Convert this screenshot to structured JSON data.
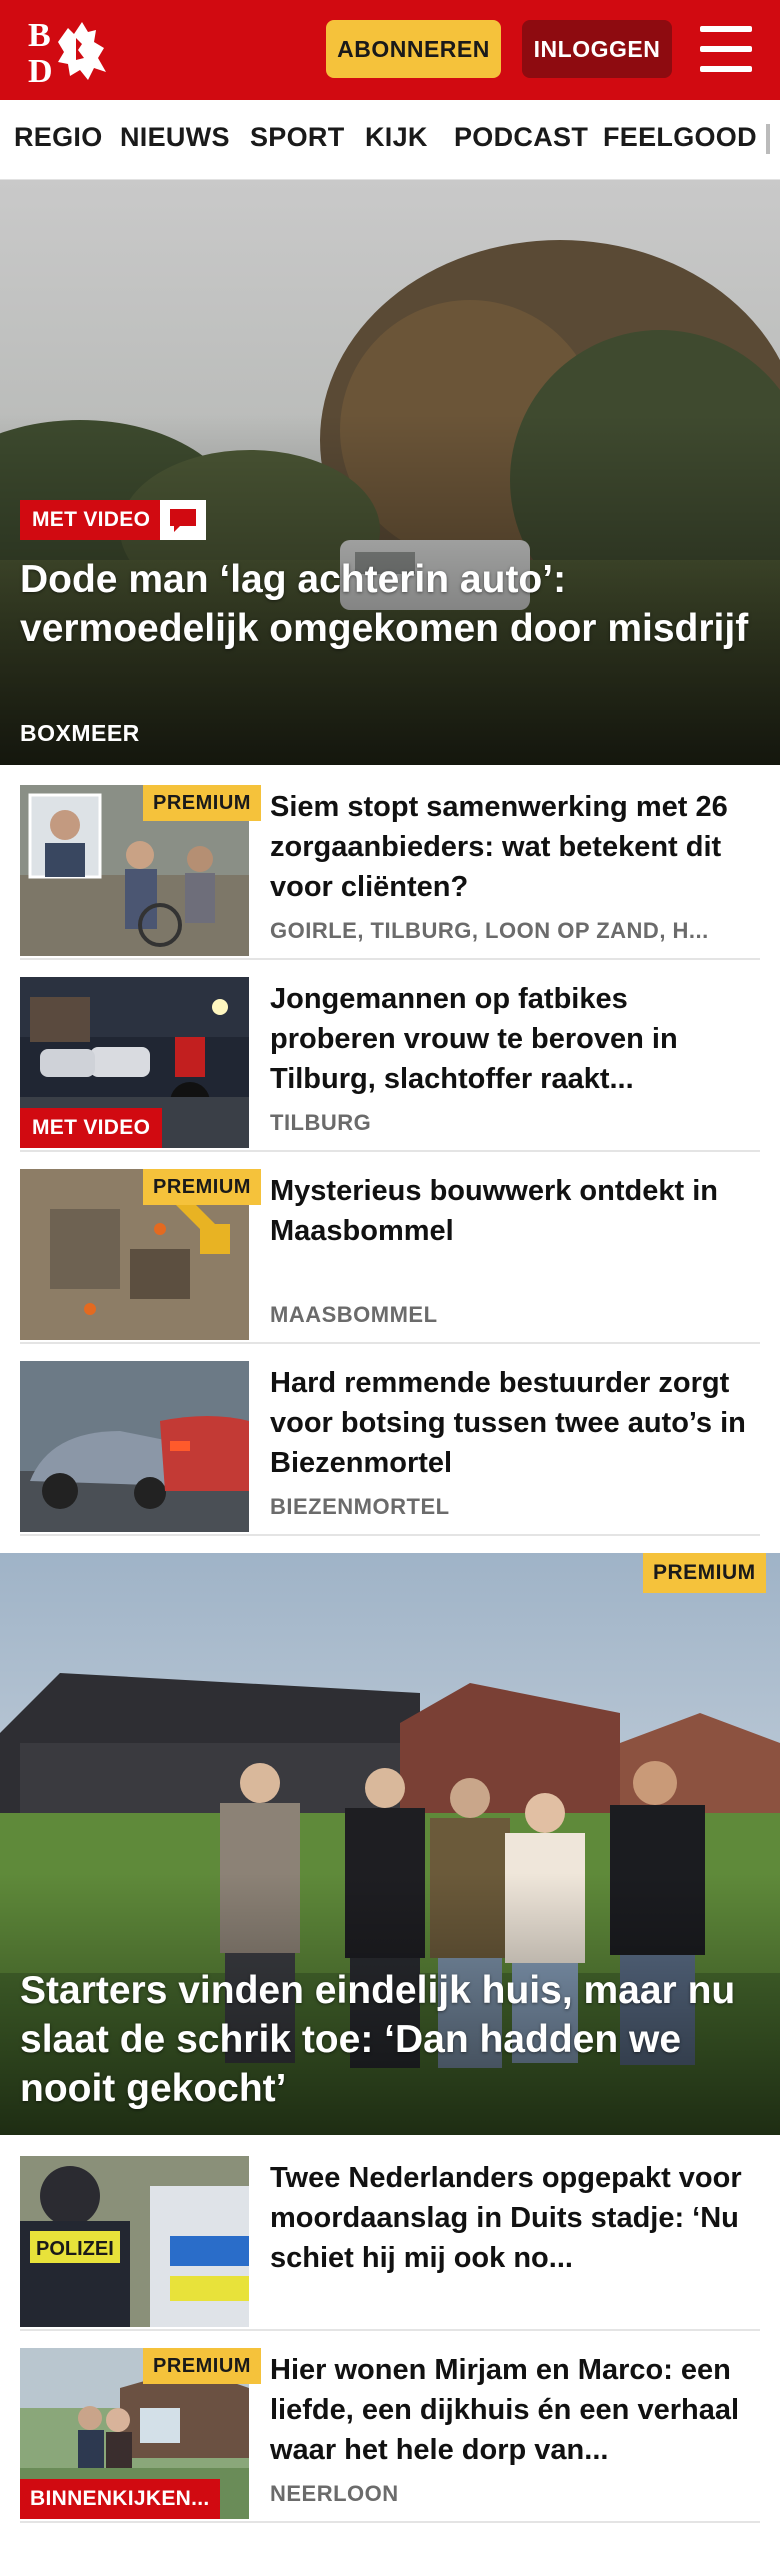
{
  "header": {
    "logo_text": "BD",
    "subscribe_label": "ABONNEREN",
    "login_label": "INLOGGEN",
    "menu_icon": "hamburger-menu-icon",
    "brand_color": "#d10a11",
    "accent_color": "#f5c23b"
  },
  "nav": {
    "items": [
      "REGIO",
      "NIEUWS",
      "SPORT",
      "KIJK",
      "PODCAST",
      "FEELGOOD"
    ]
  },
  "hero": {
    "badge": "MET VIDEO",
    "comment_icon": "comment-icon",
    "title": "Dode man ‘lag achterin auto’: vermoedelijk omgekomen door misdrijf",
    "location": "BOXMEER"
  },
  "articles": [
    {
      "badge": "PREMIUM",
      "title": "Siem stopt samenwerking met 26 zorgaanbieders: wat betekent dit voor cliënten?",
      "location": "GOIRLE, TILBURG, LOON OP ZAND, H..."
    },
    {
      "badge": "MET VIDEO",
      "title": "Jongemannen op fatbikes proberen vrouw te beroven in Tilburg, slachtoffer raakt...",
      "location": "TILBURG"
    },
    {
      "badge": "PREMIUM",
      "title": "Mysterieus bouwwerk ontdekt in Maasbommel",
      "location": "MAASBOMMEL"
    },
    {
      "badge": "",
      "title": "Hard remmende bestuurder zorgt voor botsing tussen twee auto’s in Biezenmortel",
      "location": "BIEZENMORTEL"
    }
  ],
  "hero2": {
    "badge": "PREMIUM",
    "title": "Starters vinden eindelijk huis, maar nu slaat de schrik toe: ‘Dan hadden we nooit gekocht’"
  },
  "articles2": [
    {
      "badge": "",
      "title": "Twee Nederlanders opgepakt voor moordaanslag in Duits stadje: ‘Nu schiet hij mij ook no...",
      "location": "",
      "thumb_text": "POLIZEI"
    },
    {
      "badge": "PREMIUM",
      "badge2": "BINNENKIJKEN...",
      "title": "Hier wonen Mirjam en Marco: een liefde, een dijkhuis én een verhaal waar het hele dorp van...",
      "location": "NEERLOON"
    }
  ]
}
